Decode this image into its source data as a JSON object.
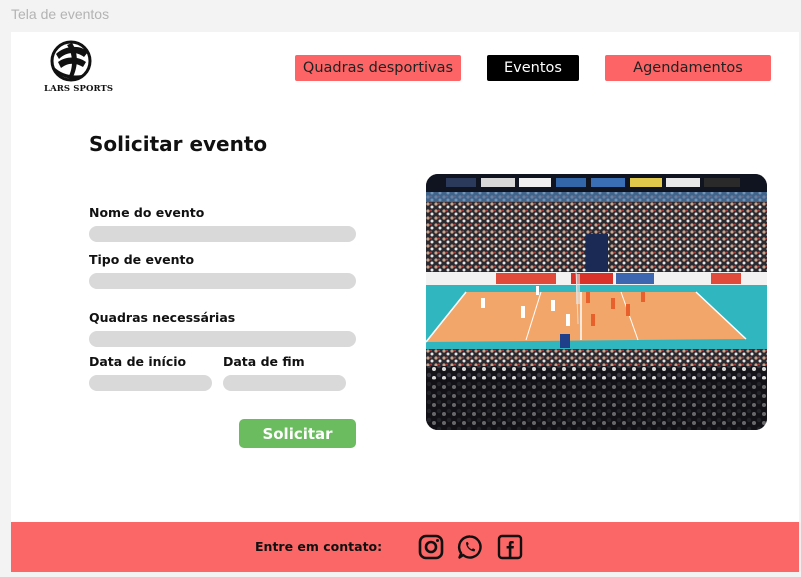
{
  "frame_label": "Tela de eventos",
  "brand": {
    "logo_text": "LARS SPORTS"
  },
  "nav": {
    "quadras": "Quadras desportivas",
    "eventos": "Eventos",
    "agendamentos": "Agendamentos"
  },
  "form": {
    "title": "Solicitar evento",
    "fields": {
      "nome": {
        "label": "Nome do evento",
        "value": ""
      },
      "tipo": {
        "label": "Tipo de evento",
        "value": ""
      },
      "quadras": {
        "label": "Quadras necessárias",
        "value": ""
      },
      "data_inicio": {
        "label": "Data de início",
        "value": ""
      },
      "data_fim": {
        "label": "Data de fim",
        "value": ""
      }
    },
    "submit_label": "Solicitar"
  },
  "footer": {
    "contact_text": "Entre em contato:",
    "social_icons": [
      "instagram-icon",
      "whatsapp-icon",
      "facebook-icon"
    ]
  },
  "colors": {
    "nav_inactive": "#fc6465",
    "nav_active": "#000000",
    "submit": "#6abc5e",
    "footer": "#fb6667",
    "input": "#d9d9d9"
  }
}
